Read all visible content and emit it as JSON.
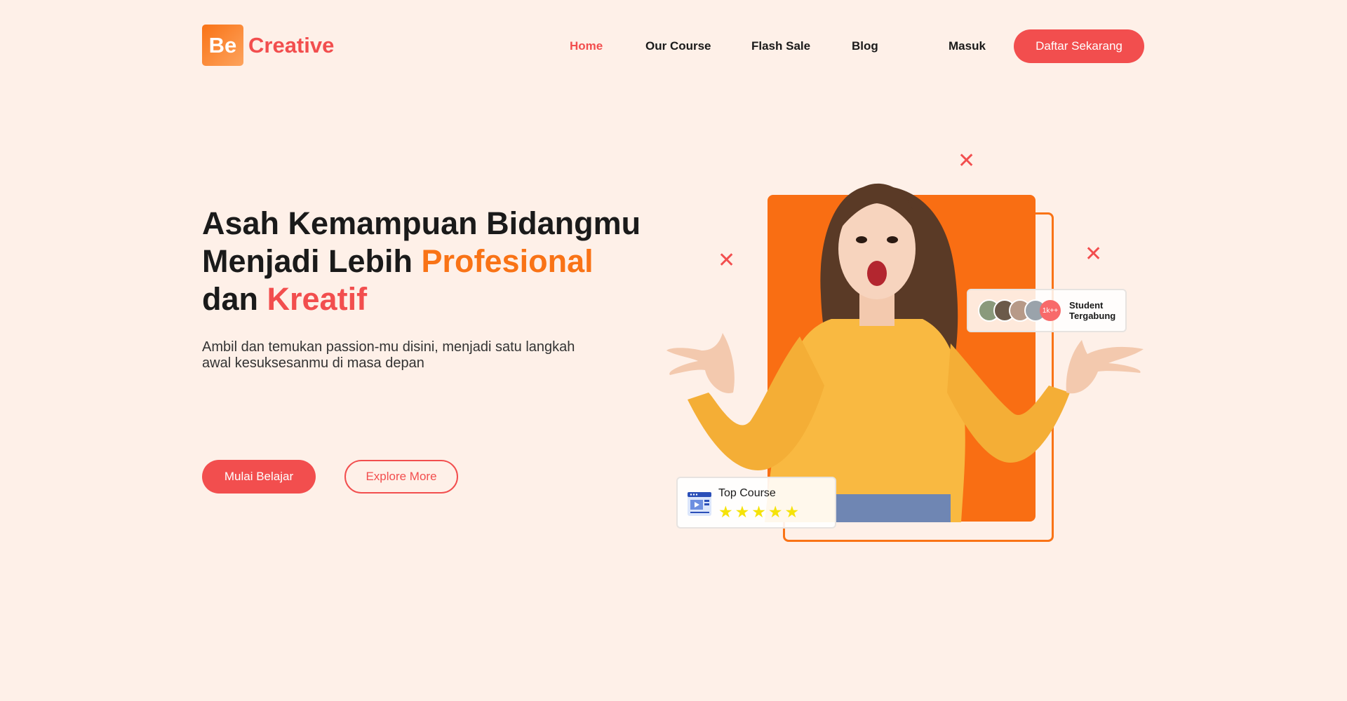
{
  "brand": {
    "logo_mark": "Be",
    "name": "Creative"
  },
  "nav": {
    "home": "Home",
    "course": "Our Course",
    "flash_sale": "Flash Sale",
    "blog": "Blog",
    "login": "Masuk",
    "register": "Daftar Sekarang"
  },
  "hero": {
    "line1": "Asah Kemampuan Bidangmu",
    "line2_prefix": "Menjadi Lebih ",
    "line2_highlight": "Profesional",
    "line3_prefix": "dan ",
    "line3_highlight": "Kreatif",
    "subtitle_line1": "Ambil dan temukan passion-mu disini, menjadi satu langkah",
    "subtitle_line2": "awal kesuksesanmu di masa depan",
    "cta_primary": "Mulai Belajar",
    "cta_secondary": "Explore More"
  },
  "student_card": {
    "count": "1k++",
    "label_line1": "Student",
    "label_line2": "Tergabung"
  },
  "course_card": {
    "label": "Top Course",
    "rating": 5,
    "stars": [
      "★",
      "★",
      "★",
      "★",
      "★"
    ]
  },
  "colors": {
    "background": "#FEF0E8",
    "accent_red": "#F24E4E",
    "accent_orange": "#F97316",
    "star": "#F5E30A"
  }
}
